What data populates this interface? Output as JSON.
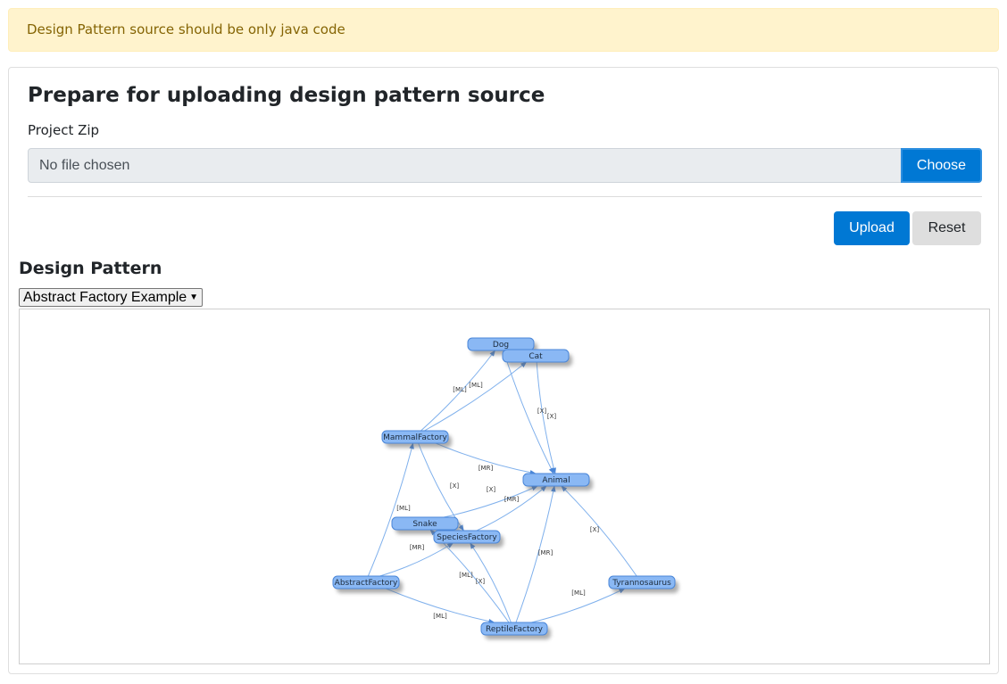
{
  "alert": {
    "message": "Design Pattern source should be only java code"
  },
  "upload_form": {
    "title": "Prepare for uploading design pattern source",
    "project_zip_label": "Project Zip",
    "file_placeholder": "No file chosen",
    "choose_label": "Choose",
    "upload_label": "Upload",
    "reset_label": "Reset"
  },
  "design_pattern": {
    "section_title": "Design Pattern",
    "selected_example": "Abstract Factory Example",
    "diagram": {
      "nodes": [
        {
          "id": "dog",
          "label": "Dog"
        },
        {
          "id": "cat",
          "label": "Cat"
        },
        {
          "id": "mammal_factory",
          "label": "MammalFactory"
        },
        {
          "id": "animal",
          "label": "Animal"
        },
        {
          "id": "snake",
          "label": "Snake"
        },
        {
          "id": "species_factory",
          "label": "SpeciesFactory"
        },
        {
          "id": "abstract_factory",
          "label": "AbstractFactory"
        },
        {
          "id": "tyrannosaurus",
          "label": "Tyrannosaurus"
        },
        {
          "id": "reptile_factory",
          "label": "ReptileFactory"
        }
      ],
      "edges": [
        {
          "from": "mammal_factory",
          "to": "dog",
          "label": "[ML]"
        },
        {
          "from": "mammal_factory",
          "to": "cat",
          "label": "[ML]"
        },
        {
          "from": "dog",
          "to": "animal",
          "label": "[X]"
        },
        {
          "from": "cat",
          "to": "animal",
          "label": "[X]"
        },
        {
          "from": "mammal_factory",
          "to": "animal",
          "label": "[MR]"
        },
        {
          "from": "mammal_factory",
          "to": "species_factory",
          "label": "[X]"
        },
        {
          "from": "snake",
          "to": "animal",
          "label": "[X]"
        },
        {
          "from": "species_factory",
          "to": "animal",
          "label": "[MR]"
        },
        {
          "from": "abstract_factory",
          "to": "mammal_factory",
          "label": "[ML]"
        },
        {
          "from": "abstract_factory",
          "to": "species_factory",
          "label": "[MR]"
        },
        {
          "from": "reptile_factory",
          "to": "snake",
          "label": "[ML]"
        },
        {
          "from": "reptile_factory",
          "to": "species_factory",
          "label": "[X]"
        },
        {
          "from": "reptile_factory",
          "to": "animal",
          "label": "[MR]"
        },
        {
          "from": "tyrannosaurus",
          "to": "animal",
          "label": "[X]"
        },
        {
          "from": "reptile_factory",
          "to": "tyrannosaurus",
          "label": "[ML]"
        },
        {
          "from": "abstract_factory",
          "to": "reptile_factory",
          "label": "[ML]"
        }
      ]
    }
  },
  "colors": {
    "primary": "#0078d4",
    "alert_bg": "#fff3cd",
    "alert_text": "#856404",
    "node_fill": "#8ab8f4",
    "edge": "#7fb0ec"
  }
}
